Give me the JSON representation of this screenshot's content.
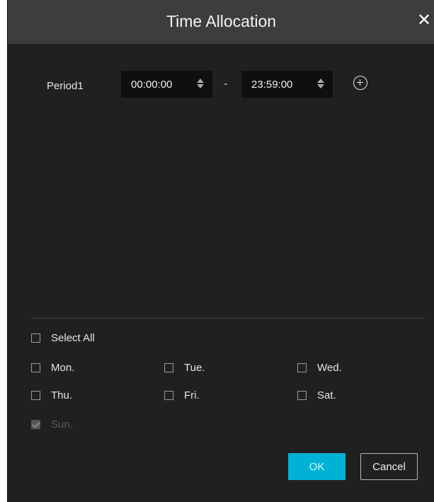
{
  "dialog": {
    "title": "Time Allocation",
    "close_symbol": "✕"
  },
  "periods": [
    {
      "label": "Period1",
      "start": "00:00:00",
      "end": "23:59:00"
    }
  ],
  "separator": "-",
  "add_icon": "plus-circle-icon",
  "select_all": {
    "label": "Select All",
    "checked": false
  },
  "days": [
    {
      "label": "Mon.",
      "checked": false,
      "disabled": false
    },
    {
      "label": "Tue.",
      "checked": false,
      "disabled": false
    },
    {
      "label": "Wed.",
      "checked": false,
      "disabled": false
    },
    {
      "label": "Thu.",
      "checked": false,
      "disabled": false
    },
    {
      "label": "Fri.",
      "checked": false,
      "disabled": false
    },
    {
      "label": "Sat.",
      "checked": false,
      "disabled": false
    },
    {
      "label": "Sun.",
      "checked": true,
      "disabled": true
    }
  ],
  "buttons": {
    "ok": "OK",
    "cancel": "Cancel"
  },
  "colors": {
    "background": "#202020",
    "titlebar": "#3d3d3d",
    "accent": "#00b3d6"
  }
}
